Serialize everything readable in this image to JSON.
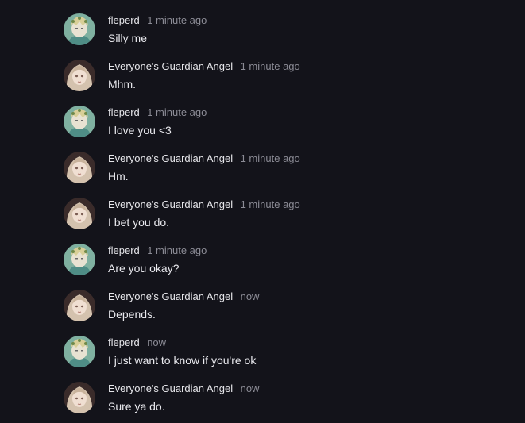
{
  "colors": {
    "background": "#13131a",
    "author": "#e6e6ea",
    "timestamp": "#8c8c96",
    "message_text": "#e9e9ee"
  },
  "messages": [
    {
      "author": "fleperd",
      "time": "1 minute ago",
      "text": "Silly me",
      "avatar": "avatar-fleperd-icon"
    },
    {
      "author": "Everyone's Guardian Angel",
      "time": "1 minute ago",
      "text": "Mhm.",
      "avatar": "avatar-angel-icon"
    },
    {
      "author": "fleperd",
      "time": "1 minute ago",
      "text": "I love you <3",
      "avatar": "avatar-fleperd-icon"
    },
    {
      "author": "Everyone's Guardian Angel",
      "time": "1 minute ago",
      "text": "Hm.",
      "avatar": "avatar-angel-icon"
    },
    {
      "author": "Everyone's Guardian Angel",
      "time": "1 minute ago",
      "text": "I bet you do.",
      "avatar": "avatar-angel-icon"
    },
    {
      "author": "fleperd",
      "time": "1 minute ago",
      "text": "Are you okay?",
      "avatar": "avatar-fleperd-icon"
    },
    {
      "author": "Everyone's Guardian Angel",
      "time": "now",
      "text": "Depends.",
      "avatar": "avatar-angel-icon"
    },
    {
      "author": "fleperd",
      "time": "now",
      "text": "I just want to know if you're ok",
      "avatar": "avatar-fleperd-icon"
    },
    {
      "author": "Everyone's Guardian Angel",
      "time": "now",
      "text": "Sure ya do.",
      "avatar": "avatar-angel-icon"
    }
  ]
}
